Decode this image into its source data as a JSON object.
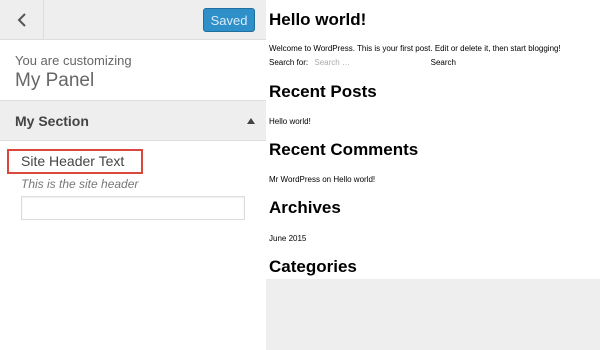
{
  "sidebar": {
    "saved_label": "Saved",
    "customizing_label": "You are customizing",
    "panel_title": "My Panel",
    "section_title": "My Section",
    "control": {
      "label": "Site Header Text",
      "description": "This is the site header",
      "value": ""
    }
  },
  "preview": {
    "post_title": "Hello world!",
    "post_excerpt": "Welcome to WordPress. This is your first post. Edit or delete it, then start blogging!",
    "search": {
      "label": "Search for:",
      "placeholder": "Search …",
      "button": "Search"
    },
    "recent_posts": {
      "heading": "Recent Posts",
      "items": [
        "Hello world!"
      ]
    },
    "recent_comments": {
      "heading": "Recent Comments",
      "author": "Mr WordPress",
      "on": "on",
      "post": "Hello world!"
    },
    "archives": {
      "heading": "Archives",
      "items": [
        "June 2015"
      ]
    },
    "categories": {
      "heading": "Categories"
    }
  },
  "icons": {
    "back": "chevron-left-icon",
    "section_toggle": "arrow-up-icon"
  },
  "colors": {
    "primary_button": "#2e8fc9",
    "highlight_border": "#d9483b"
  }
}
